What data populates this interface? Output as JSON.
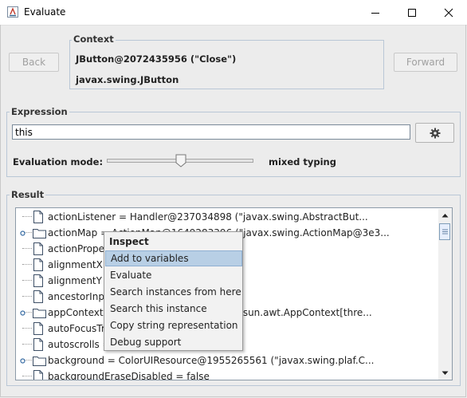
{
  "window": {
    "title": "Evaluate"
  },
  "nav": {
    "back_label": "Back",
    "forward_label": "Forward"
  },
  "context": {
    "title": "Context",
    "line1": "JButton@2072435956 (\"Close\")",
    "line2": "javax.swing.JButton"
  },
  "expression": {
    "title": "Expression",
    "value": "this",
    "mode_label": "Evaluation mode:",
    "mode_value": "mixed typing",
    "settings_icon": "gear-icon"
  },
  "result": {
    "title": "Result",
    "rows": [
      {
        "text": "actionListener = Handler@237034898 (\"javax.swing.AbstractBut...",
        "kind": "leaf"
      },
      {
        "text": "actionMap = ActionMap@1649283396 (\"javax.swing.ActionMap@3e3...",
        "kind": "folder"
      },
      {
        "text": "actionPropertyChangeListener = null",
        "kind": "leaf"
      },
      {
        "text": "alignmentX = 0.0",
        "kind": "leaf"
      },
      {
        "text": "alignmentY = 0.5",
        "kind": "leaf"
      },
      {
        "text": "ancestorInputMap = null",
        "kind": "leaf"
      },
      {
        "text": "appContext = AppContext@11222233 (\"sun.awt.AppContext[thre...",
        "kind": "folder"
      },
      {
        "text": "autoFocusTraversalKeys = null",
        "kind": "leaf"
      },
      {
        "text": "autoscrolls = false",
        "kind": "leaf"
      },
      {
        "text": "background = ColorUIResource@1955265561 (\"javax.swing.plaf.C...",
        "kind": "folder"
      },
      {
        "text": "backgroundEraseDisabled = false",
        "kind": "leaf"
      }
    ]
  },
  "context_menu": {
    "header": "Inspect",
    "items": [
      {
        "label": "Add to variables",
        "selected": true
      },
      {
        "label": "Evaluate",
        "selected": false
      },
      {
        "label": "Search instances from here",
        "selected": false
      },
      {
        "label": "Search this instance",
        "selected": false
      },
      {
        "label": "Copy string representation",
        "selected": false
      },
      {
        "label": "Debug support",
        "selected": false
      }
    ]
  }
}
